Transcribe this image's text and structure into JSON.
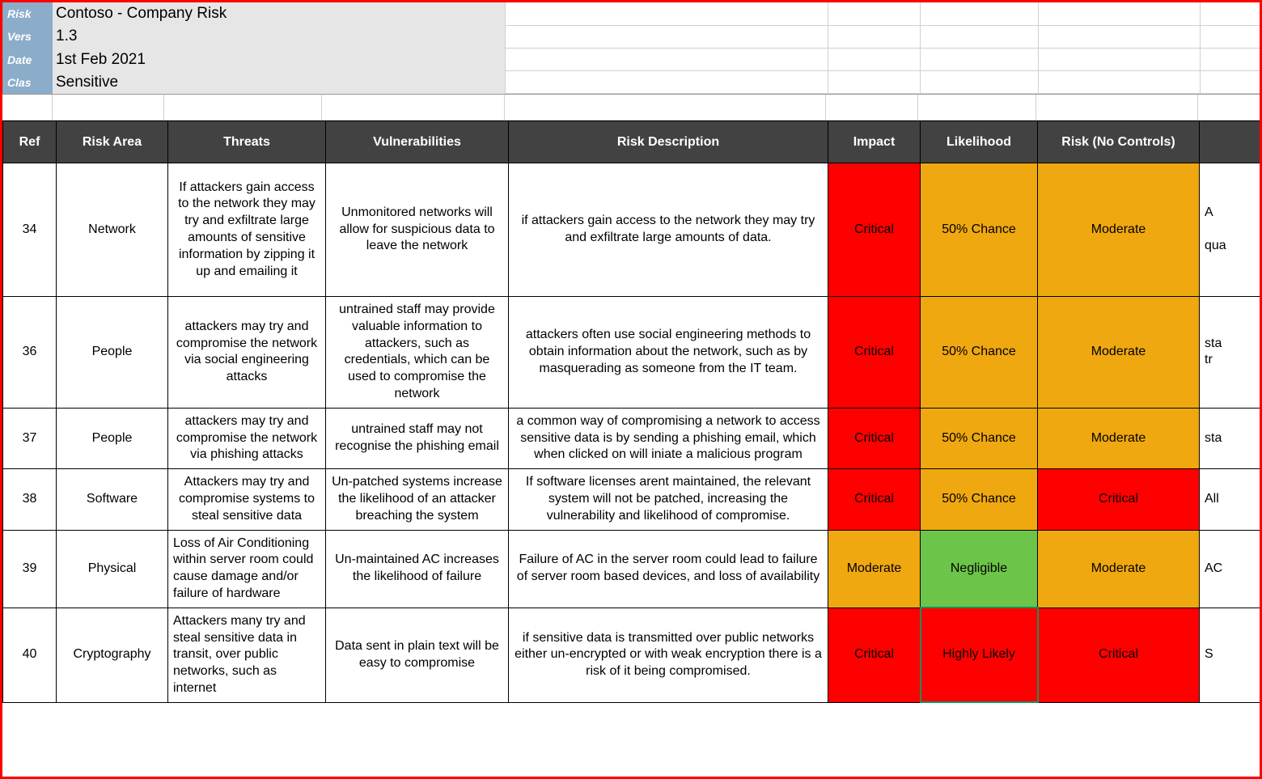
{
  "meta": {
    "labels": {
      "risk": "Risk",
      "version": "Vers",
      "date": "Date",
      "class": "Clas"
    },
    "values": {
      "risk": "Contoso - Company Risk",
      "version": "1.3",
      "date": "1st Feb 2021",
      "class": "Sensitive"
    }
  },
  "columns": {
    "ref": "Ref",
    "area": "Risk Area",
    "threats": "Threats",
    "vuln": "Vulnerabilities",
    "desc": "Risk Description",
    "impact": "Impact",
    "likelihood": "Likelihood",
    "risk": "Risk (No Controls)"
  },
  "levels": {
    "critical": "Critical",
    "moderate": "Moderate",
    "negligible": "Negligible",
    "highly_likely": "Highly Likely",
    "fifty": "50% Chance"
  },
  "rows": [
    {
      "ref": "34",
      "area": "Network",
      "threats": "If attackers gain access to the network they may try and exfiltrate large amounts of sensitive information by zipping it up and emailing it",
      "vuln": "Unmonitored networks will allow for suspicious data to leave the network",
      "desc": "if attackers gain access to the network they may try and exfiltrate large amounts of data.",
      "impact": "Critical",
      "impact_color": "red",
      "likelihood": "50% Chance",
      "likelihood_color": "orange",
      "risk": "Moderate",
      "risk_color": "orange",
      "extra": "A\n\nqua"
    },
    {
      "ref": "36",
      "area": "People",
      "threats": "attackers may try and compromise the network via social engineering attacks",
      "vuln": "untrained staff may provide valuable information to attackers, such as credentials, which can be used to compromise the network",
      "desc": "attackers often use social engineering methods to obtain information about the network, such as by masquerading as someone from the IT team.",
      "impact": "Critical",
      "impact_color": "red",
      "likelihood": "50% Chance",
      "likelihood_color": "orange",
      "risk": "Moderate",
      "risk_color": "orange",
      "extra": "sta\ntr"
    },
    {
      "ref": "37",
      "area": "People",
      "threats": "attackers may try and compromise the network via phishing attacks",
      "vuln": "untrained staff may not recognise the phishing email",
      "desc": "a common way of compromising a network to access sensitive data is by sending a phishing email, which when clicked on will iniate a malicious program",
      "impact": "Critical",
      "impact_color": "red",
      "likelihood": "50% Chance",
      "likelihood_color": "orange",
      "risk": "Moderate",
      "risk_color": "orange",
      "extra": "sta"
    },
    {
      "ref": "38",
      "area": "Software",
      "threats": "Attackers may try and compromise systems to steal sensitive data",
      "vuln": "Un-patched systems increase the likelihood of an attacker breaching the system",
      "desc": "If software licenses arent maintained, the relevant system will not be patched, increasing the vulnerability and likelihood of compromise.",
      "impact": "Critical",
      "impact_color": "red",
      "likelihood": "50% Chance",
      "likelihood_color": "orange",
      "risk": "Critical",
      "risk_color": "red",
      "extra": "All"
    },
    {
      "ref": "39",
      "area": "Physical",
      "threats": "Loss of Air Conditioning within server room could cause damage and/or failure of hardware",
      "vuln": "Un-maintained AC increases the likelihood of failure",
      "desc": "Failure of AC in the server room could lead to failure of server room based devices, and loss of availability",
      "impact": "Moderate",
      "impact_color": "orange",
      "likelihood": "Negligible",
      "likelihood_color": "green",
      "risk": "Moderate",
      "risk_color": "orange",
      "extra": "AC"
    },
    {
      "ref": "40",
      "area": "Cryptography",
      "threats": "Attackers many try and steal sensitive data in transit, over public networks, such as internet",
      "vuln": "Data sent in plain text will be easy to compromise",
      "desc": "if sensitive data is transmitted over public networks either un-encrypted or with weak encryption there is a risk of it being compromised.",
      "impact": "Critical",
      "impact_color": "red",
      "likelihood": "Highly Likely",
      "likelihood_color": "red",
      "selected": true,
      "risk": "Critical",
      "risk_color": "red",
      "extra": "S"
    }
  ]
}
